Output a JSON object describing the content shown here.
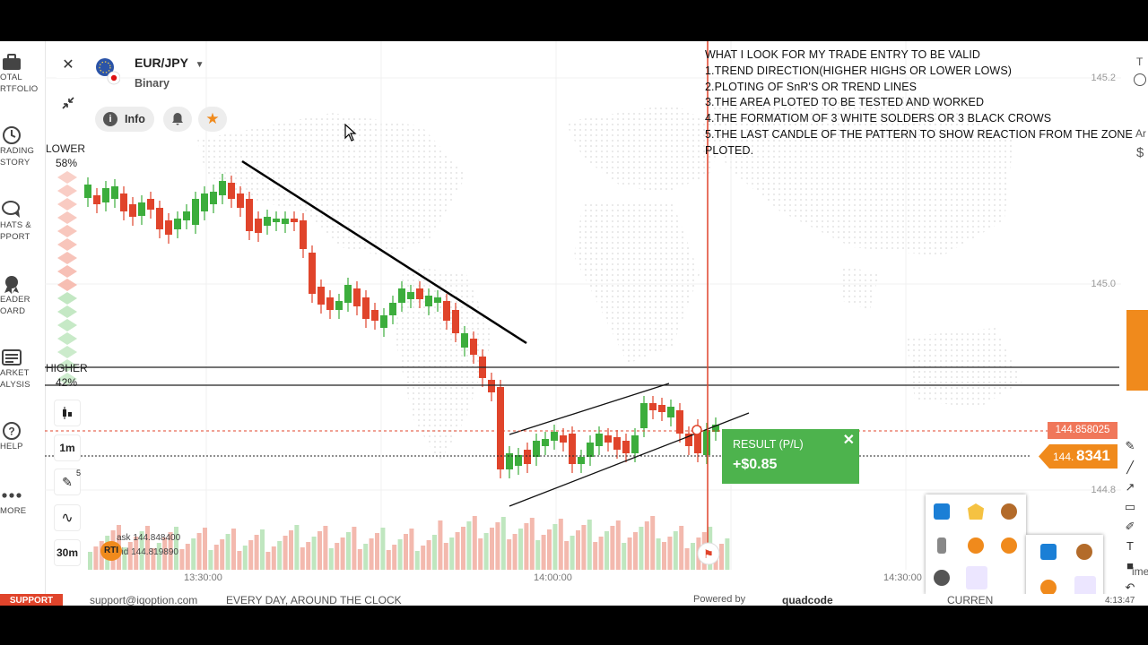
{
  "sidebar": {
    "items": [
      {
        "label": "OTAL\nRTFOLIO",
        "icon": "briefcase-icon"
      },
      {
        "label": "RADING\nSTORY",
        "icon": "clock-icon"
      },
      {
        "label": "HATS &\nPPORT",
        "icon": "chat-icon"
      },
      {
        "label": "EADER\nOARD",
        "icon": "trophy-icon"
      },
      {
        "label": "ARKET\nALYSIS",
        "icon": "newspaper-icon"
      },
      {
        "label": "HELP",
        "icon": "help-icon"
      },
      {
        "label": "MORE",
        "icon": "more-dots-icon"
      }
    ]
  },
  "asset": {
    "pair": "EUR/JPY",
    "type": "Binary"
  },
  "header_buttons": {
    "info": "Info"
  },
  "forecast": {
    "lower_label": "LOWER",
    "lower_pct": "58%",
    "higher_label": "HIGHER",
    "higher_pct": "42%"
  },
  "left_tools": {
    "timeframe": "1m",
    "drawing_count": "5",
    "period": "30m"
  },
  "notes": [
    "WHAT I LOOK FOR MY TRADE ENTRY TO BE VALID",
    "1.TREND DIRECTION(HIGHER HIGHS OR LOWER LOWS)",
    "2.PLOTING OF SnR'S OR TREND LINES",
    "3.THE AREA PLOTED TO BE TESTED AND WORKED",
    "4.THE FORMATIOM OF 3 WHITE SOLDERS OR 3 BLACK CROWS",
    "5.THE LAST CANDLE OF THE PATTERN TO SHOW REACTION FROM THE ZONE",
    "PLOTED."
  ],
  "y_ticks": [
    "145.2",
    "145.0",
    "144.8"
  ],
  "x_ticks": [
    "13:30:00",
    "14:00:00",
    "14:30:00"
  ],
  "price": {
    "strike": "144.858025",
    "current_prefix": "144.",
    "current_suffix": "8341"
  },
  "quotes": {
    "ask": "ask 144.848400",
    "bid": "bid 144.819890"
  },
  "result": {
    "title": "RESULT (P/L)",
    "value": "+$0.85"
  },
  "footer": {
    "support": "SUPPORT",
    "email": "support@iqoption.com",
    "hours": "EVERY DAY, AROUND THE CLOCK",
    "powered": "Powered by",
    "brand": "quadcode",
    "current": "CURREN",
    "time": "4:13:47"
  },
  "right_edge": {
    "t": "T",
    "ar": "Ar",
    "s": "$",
    "ime": "ime"
  },
  "colors": {
    "bull": "#3cad3c",
    "bear": "#e0442b",
    "accent": "#f08a1c",
    "result_bg": "#4db34d"
  }
}
